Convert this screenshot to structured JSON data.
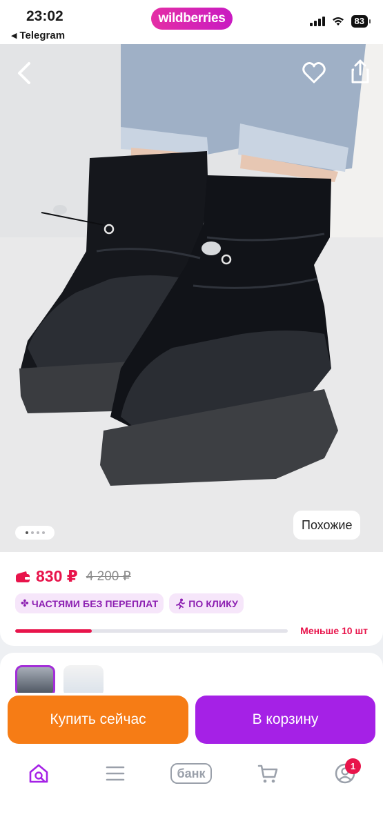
{
  "status_bar": {
    "time": "23:02",
    "back_app": "Telegram",
    "back_icon": "triangle-left-icon",
    "brand": "wildberries",
    "battery": "83"
  },
  "product_nav": {
    "back_icon": "chevron-left-icon",
    "favorite_icon": "heart-icon",
    "share_icon": "share-icon"
  },
  "gallery": {
    "image_count": 4,
    "active_index": 0,
    "similar_label": "Похожие"
  },
  "price": {
    "wallet_icon": "wallet-icon",
    "current": "830 ₽",
    "old": "4 200 ₽",
    "badges": [
      {
        "icon": "clover-icon",
        "label": "ЧАСТЯМИ БЕЗ ПЕРЕПЛАТ"
      },
      {
        "icon": "running-person-icon",
        "label": "ПО КЛИКУ"
      }
    ],
    "stock_fraction": 0.28,
    "stock_label": "Меньше 10 шт"
  },
  "actions": {
    "buy_now": "Купить сейчас",
    "add_to_cart": "В корзину"
  },
  "bottom_nav": {
    "items": [
      {
        "icon": "home-search-icon",
        "label": ""
      },
      {
        "icon": "menu-icon",
        "label": ""
      },
      {
        "icon": "bank-icon",
        "label": "банк"
      },
      {
        "icon": "cart-icon",
        "label": ""
      },
      {
        "icon": "profile-icon",
        "label": ""
      }
    ],
    "profile_badge": "1"
  },
  "colors": {
    "accent_purple": "#a521e6",
    "buy_orange": "#f67c15",
    "price_red": "#e8144b",
    "badge_bg": "#f6e6fa",
    "badge_text": "#8c1fb1"
  }
}
